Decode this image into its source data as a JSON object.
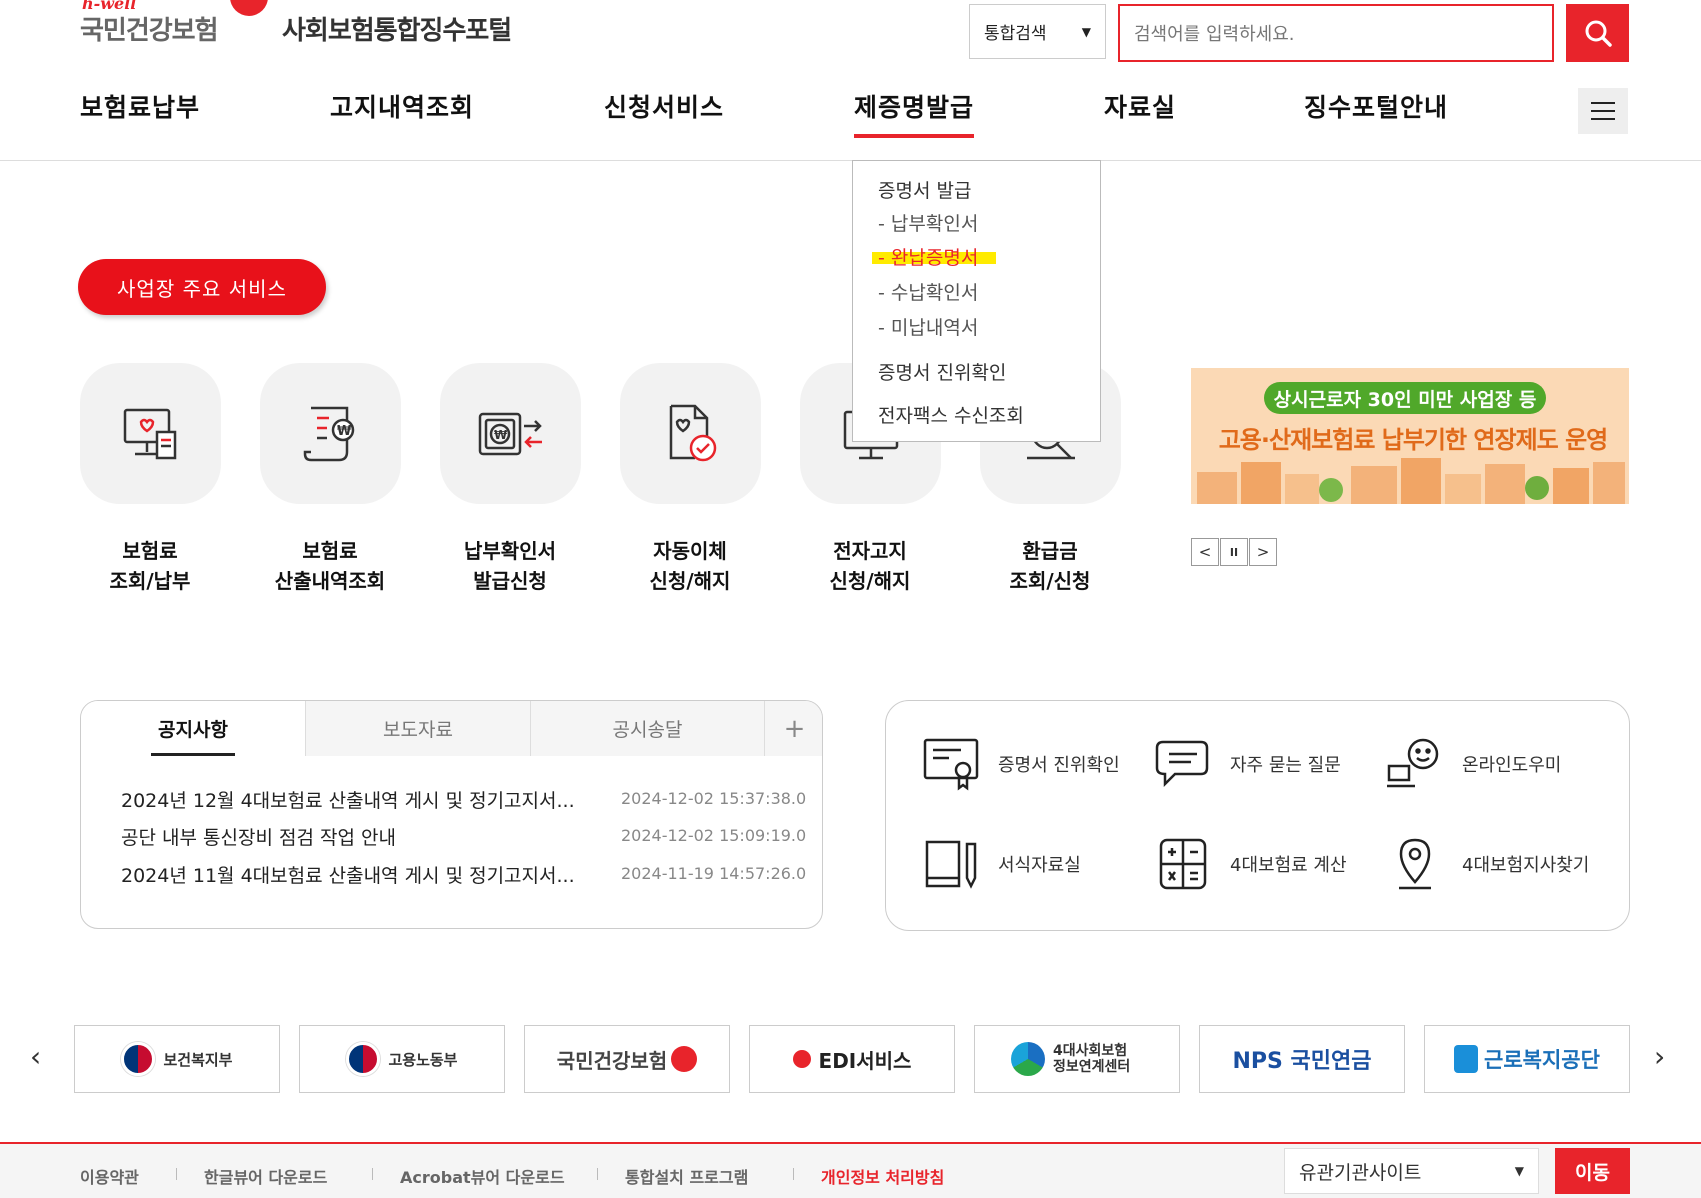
{
  "header": {
    "logo_tag": "h-well",
    "logo_name": "국민건강보험",
    "portal_title": "사회보험통합징수포털",
    "search_scope": "통합검색",
    "search_placeholder": "검색어를 입력하세요."
  },
  "gnb": {
    "items": [
      {
        "label": "보험료납부"
      },
      {
        "label": "고지내역조회"
      },
      {
        "label": "신청서비스"
      },
      {
        "label": "제증명발급",
        "active": true
      },
      {
        "label": "자료실"
      },
      {
        "label": "징수포털안내"
      }
    ]
  },
  "dropdown": {
    "items": [
      {
        "label": "증명서 발급"
      },
      {
        "label": "- 납부확인서"
      },
      {
        "label": "- 완납증명서",
        "highlighted": true
      },
      {
        "label": "- 수납확인서"
      },
      {
        "label": "- 미납내역서"
      },
      {
        "label": "증명서 진위확인"
      },
      {
        "label": "전자팩스 수신조회"
      }
    ]
  },
  "services": {
    "pill": "사업장 주요 서비스",
    "items": [
      {
        "line1": "보험료",
        "line2": "조회/납부",
        "icon": "monitor-receipt-icon"
      },
      {
        "line1": "보험료",
        "line2": "산출내역조회",
        "icon": "calculation-list-icon"
      },
      {
        "line1": "납부확인서",
        "line2": "발급신청",
        "icon": "payment-certificate-icon"
      },
      {
        "line1": "자동이체",
        "line2": "신청/해지",
        "icon": "auto-transfer-icon"
      },
      {
        "line1": "전자고지",
        "line2": "신청/해지",
        "icon": "electronic-notice-icon"
      },
      {
        "line1": "환급금",
        "line2": "조회/신청",
        "icon": "refund-icon"
      }
    ]
  },
  "banner": {
    "tag": "상시근로자 30인 미만 사업장 등",
    "headline": "고용·산재보험료 납부기한 연장제도 운영",
    "controls": [
      "<",
      "II",
      ">"
    ]
  },
  "notice": {
    "tabs": [
      "공지사항",
      "보도자료",
      "공시송달"
    ],
    "plus": "+",
    "rows": [
      {
        "title": "2024년 12월 4대보험료 산출내역 게시 및 정기고지서...",
        "date": "2024-12-02 15:37:38.0"
      },
      {
        "title": "공단 내부 통신장비 점검 작업 안내",
        "date": "2024-12-02 15:09:19.0"
      },
      {
        "title": "2024년 11월 4대보험료 산출내역 게시 및 정기고지서...",
        "date": "2024-11-19 14:57:26.0"
      }
    ]
  },
  "quick_links": [
    {
      "label": "증명서 진위확인",
      "icon": "certificate-icon"
    },
    {
      "label": "자주 묻는 질문",
      "icon": "chat-faq-icon"
    },
    {
      "label": "온라인도우미",
      "icon": "online-helper-icon"
    },
    {
      "label": "서식자료실",
      "icon": "form-book-icon"
    },
    {
      "label": "4대보험료 계산",
      "icon": "calculator-icon"
    },
    {
      "label": "4대보험지사찾기",
      "icon": "location-pin-icon"
    }
  ],
  "partners": {
    "prev": "‹",
    "next": "›",
    "items": [
      {
        "label": "보건복지부"
      },
      {
        "label": "고용노동부"
      },
      {
        "label": "국민건강보험"
      },
      {
        "label": "EDI서비스"
      },
      {
        "label": "4대사회보험 정보연계센터"
      },
      {
        "label": "NPS 국민연금"
      },
      {
        "label": "근로복지공단"
      }
    ]
  },
  "footer": {
    "links": [
      "이용약관",
      "한글뷰어 다운로드",
      "Acrobat뷰어 다운로드",
      "통합설치 프로그램",
      "개인정보 처리방침"
    ],
    "select": "유관기관사이트",
    "go": "이동"
  },
  "colors": {
    "brand_red": "#e8242b",
    "highlight_yellow": "#ffeb00",
    "banner_green": "#50a82a",
    "banner_orange": "#e06a1a"
  }
}
